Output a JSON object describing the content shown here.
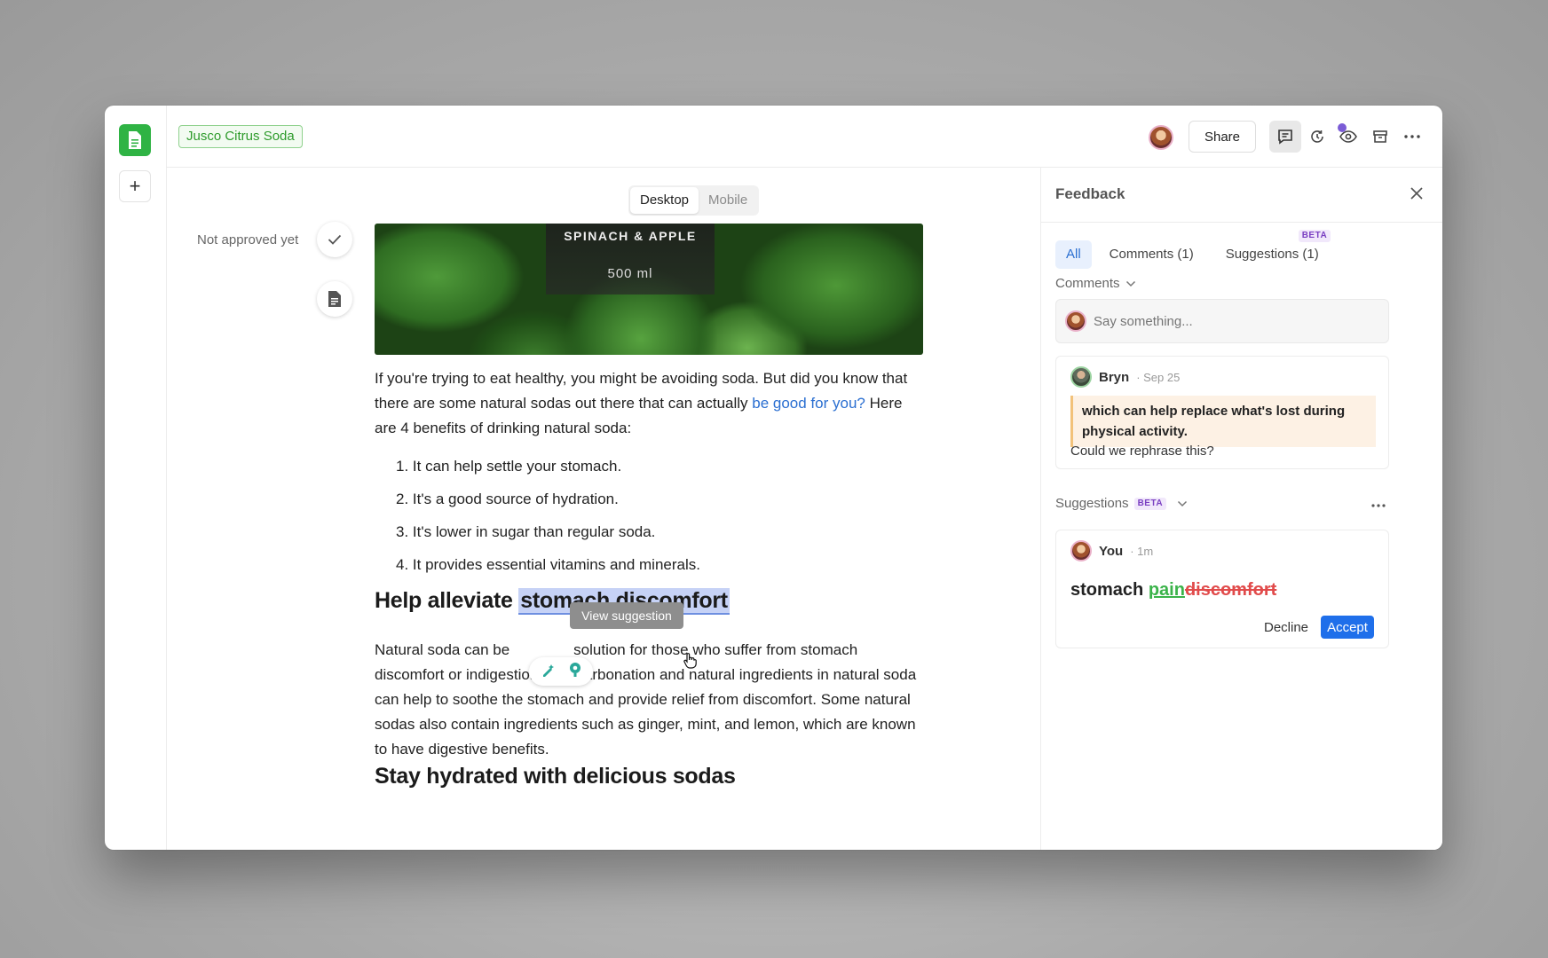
{
  "header": {
    "doc_tag": "Jusco Citrus Soda",
    "share_label": "Share"
  },
  "view_toggle": {
    "options": [
      "Desktop",
      "Mobile"
    ],
    "selected": "Desktop"
  },
  "approval": {
    "status": "Not approved yet"
  },
  "hero": {
    "line1": "SPINACH & APPLE",
    "line2": "500 ml"
  },
  "article": {
    "intro_pre": "If you're trying to eat healthy, you might be avoiding soda. But did you know that there are some natural sodas out there that can actually ",
    "intro_link": "be good for you?",
    "intro_post": " Here are 4 benefits of drinking natural soda:",
    "list": [
      "1. It can help settle your stomach.",
      "2. It's a good source of hydration.",
      "3. It's lower in sugar than regular soda.",
      "4. It provides essential vitamins and minerals."
    ],
    "h2_pre": "Help alleviate ",
    "h2_highlight": "stomach discomfort",
    "para2_a": "Natural soda can be",
    "para2_b": "solution for those who suffer from stomach discomfort or indigestion. The carbonation and natural ingredients in natural soda can help to soothe the stomach and provide relief from discomfort. Some natural sodas also contain ingredients such as ginger, mint, and lemon, which are known to have digestive benefits.",
    "h2b": "Stay hydrated with delicious sodas"
  },
  "tooltip": {
    "label": "View suggestion"
  },
  "feedback": {
    "title": "Feedback",
    "tabs": [
      "All",
      "Comments (1)",
      "Suggestions (1)"
    ],
    "beta_badge": "BETA",
    "comments_label": "Comments",
    "say_placeholder": "Say something...",
    "comment": {
      "author": "Bryn",
      "time": "· Sep 25",
      "quote": "which can help replace what's lost during physical activity.",
      "text": "Could we rephrase this?"
    },
    "suggestions_label": "Suggestions",
    "suggestion": {
      "author": "You",
      "time": "· 1m",
      "base": "stomach ",
      "inserted": "pain",
      "deleted": "discomfort",
      "decline_label": "Decline",
      "accept_label": "Accept"
    }
  },
  "colors": {
    "brand_green": "#2fb344",
    "accent_blue": "#1f6fea",
    "highlight": "#c6d2f6"
  }
}
